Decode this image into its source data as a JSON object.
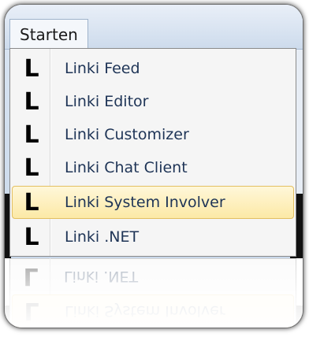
{
  "menubar": {
    "title": "Starten"
  },
  "menu": {
    "items": [
      {
        "icon": "linki-logo-icon",
        "glyph": "L",
        "label": "Linki Feed"
      },
      {
        "icon": "linki-logo-icon",
        "glyph": "L",
        "label": "Linki Editor"
      },
      {
        "icon": "linki-logo-icon",
        "glyph": "L",
        "label": "Linki Customizer"
      },
      {
        "icon": "linki-logo-icon",
        "glyph": "L",
        "label": "Linki Chat Client"
      },
      {
        "icon": "linki-logo-icon",
        "glyph": "L",
        "label": "Linki System Involver",
        "highlighted": true
      },
      {
        "icon": "linki-logo-icon",
        "glyph": "L",
        "label": "Linki .NET"
      }
    ]
  },
  "colors": {
    "menubar_blue": "#cddbec",
    "menu_background": "#f5f5f5",
    "highlight_fill": "#fce9a6",
    "highlight_border": "#e3bf61",
    "label_text": "#1e3456"
  }
}
